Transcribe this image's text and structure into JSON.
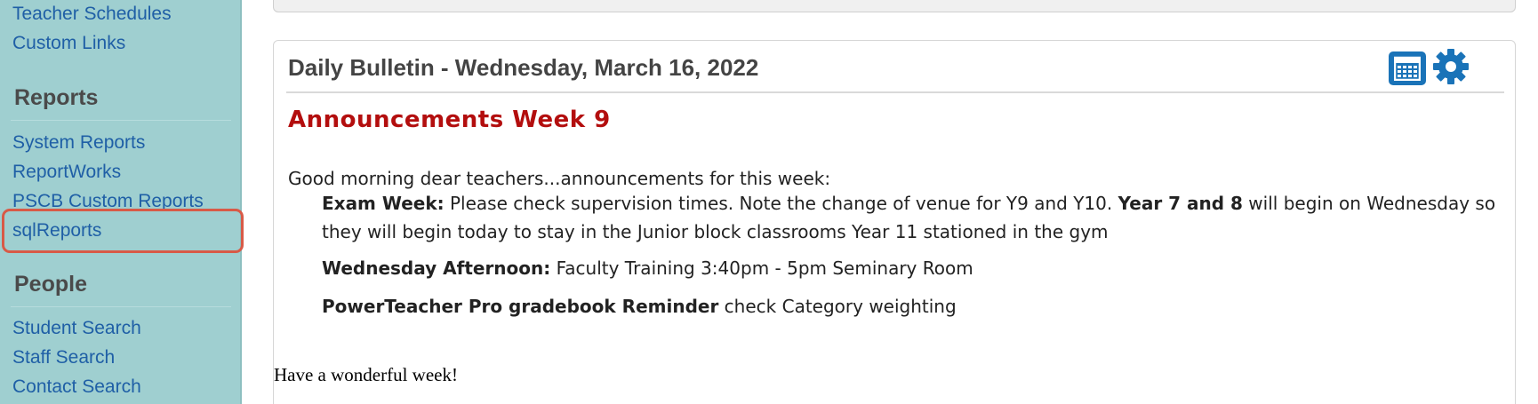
{
  "sidebar": {
    "links_top": [
      {
        "label": "Teacher Schedules"
      },
      {
        "label": "Custom Links"
      }
    ],
    "reports": {
      "heading": "Reports",
      "links": [
        {
          "label": "System Reports"
        },
        {
          "label": "ReportWorks"
        },
        {
          "label": "PSCB Custom Reports"
        },
        {
          "label": "sqlReports"
        }
      ]
    },
    "people": {
      "heading": "People",
      "links": [
        {
          "label": "Student Search"
        },
        {
          "label": "Staff Search"
        },
        {
          "label": "Contact Search"
        }
      ]
    },
    "highlighted_item": "sqlReports",
    "highlight_color": "#d85a47",
    "background_color": "#9fcfd0",
    "link_color": "#1f5fa6"
  },
  "bulletin": {
    "title": "Daily Bulletin - Wednesday, March 16, 2022",
    "icons": [
      "calendar-icon",
      "gear-icon"
    ],
    "announcement_heading": "Announcements Week 9",
    "heading_color": "#b30e0e",
    "intro": "Good morning dear teachers...announcements for this week:",
    "items": [
      {
        "bold1": "Exam Week:",
        "text1": " Please check supervision times. Note the change of venue for Y9 and Y10. ",
        "bold2": "Year 7 and 8",
        "text2": " will begin on Wednesday so they will begin today to stay in the Junior block classrooms Year 11 stationed in the gym"
      },
      {
        "bold1": "Wednesday Afternoon:",
        "text1": " Faculty Training 3:40pm - 5pm Seminary Room"
      },
      {
        "bold1": "PowerTeacher Pro gradebook Reminder",
        "text1": " check Category weighting"
      }
    ],
    "closing": "Have a wonderful week!"
  }
}
